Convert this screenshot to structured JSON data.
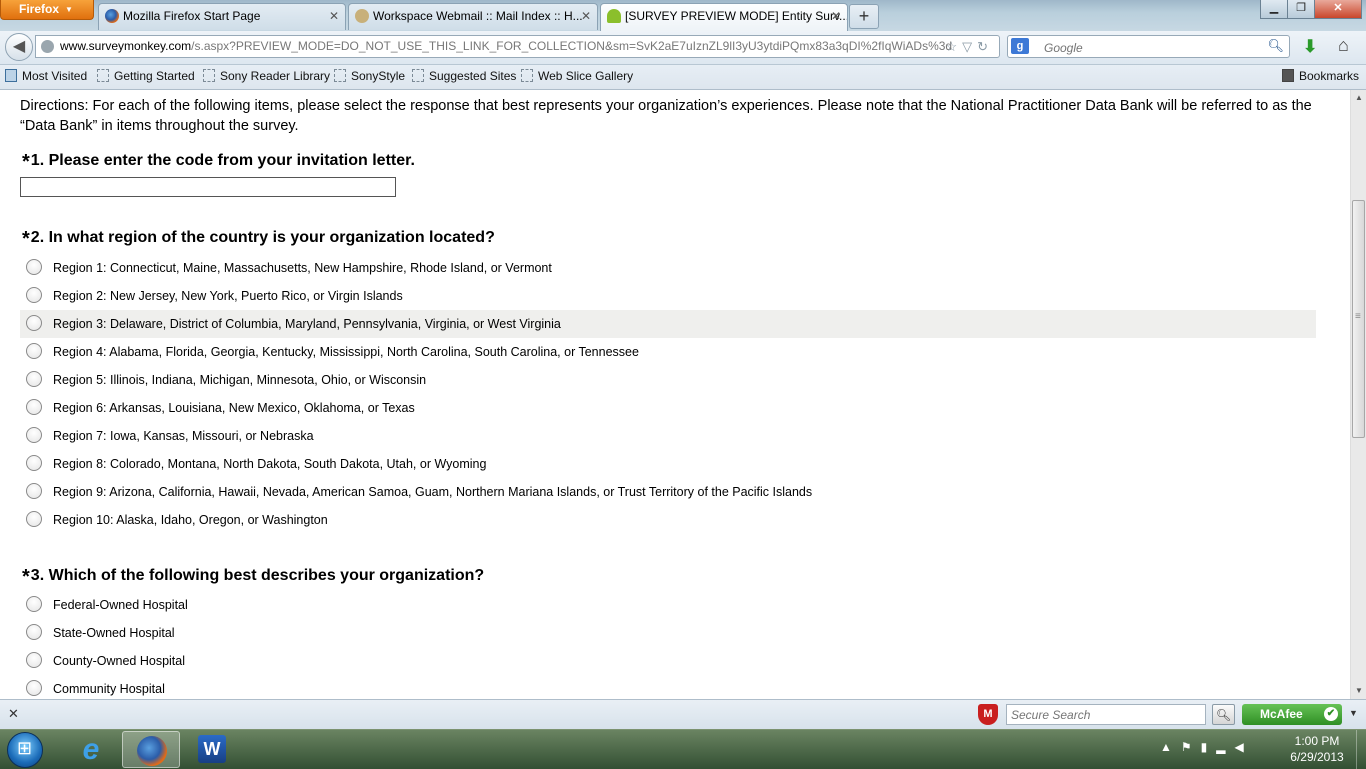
{
  "browser": {
    "menu_button": "Firefox",
    "tabs": [
      {
        "title": "Mozilla Firefox Start Page",
        "icon": "firefox-icon"
      },
      {
        "title": "Workspace Webmail :: Mail Index :: H...",
        "icon": "webmail-icon"
      },
      {
        "title": "[SURVEY PREVIEW MODE] Entity Surv...",
        "icon": "surveymonkey-icon",
        "active": true
      }
    ],
    "url_domain": "www.surveymonkey.com",
    "url_path": "/s.aspx?PREVIEW_MODE=DO_NOT_USE_THIS_LINK_FOR_COLLECTION&sm=SvK2aE7uIznZL9lI3yU3ytdiPQmx83a3qDI%2fIqWiADs%3d",
    "search_placeholder": "Google",
    "bookmarks": [
      "Most Visited",
      "Getting Started",
      "Sony Reader Library",
      "SonyStyle",
      "Suggested Sites",
      "Web Slice Gallery"
    ],
    "bookmarks_menu": "Bookmarks"
  },
  "survey": {
    "directions": "Directions: For each of the following items, please select the response that best represents your organization’s experiences. Please note that the National Practitioner Data Bank will be referred to as the “Data Bank” in items throughout the survey.",
    "required_marker": "*",
    "q1": {
      "title": "1. Please enter the code from your invitation letter.",
      "value": ""
    },
    "q2": {
      "title": "2. In what region of the country is your organization located?",
      "options": [
        "Region 1: Connecticut, Maine, Massachusetts, New Hampshire, Rhode Island, or Vermont",
        "Region 2: New Jersey, New York, Puerto Rico, or Virgin Islands",
        "Region 3: Delaware, District of Columbia, Maryland, Pennsylvania, Virginia, or West Virginia",
        "Region 4: Alabama, Florida, Georgia, Kentucky, Mississippi, North Carolina, South Carolina, or Tennessee",
        "Region 5: Illinois, Indiana, Michigan, Minnesota, Ohio, or Wisconsin",
        "Region 6: Arkansas, Louisiana, New Mexico, Oklahoma, or Texas",
        "Region 7: Iowa, Kansas, Missouri, or Nebraska",
        "Region 8: Colorado, Montana, North Dakota, South Dakota, Utah, or Wyoming",
        "Region 9: Arizona, California, Hawaii, Nevada, American Samoa, Guam, Northern Mariana Islands, or Trust Territory of the Pacific Islands",
        "Region 10: Alaska, Idaho, Oregon, or Washington"
      ]
    },
    "q3": {
      "title": "3. Which of the following best describes your organization?",
      "options": [
        "Federal-Owned Hospital",
        "State-Owned Hospital",
        "County-Owned Hospital",
        "Community Hospital"
      ]
    }
  },
  "addon_bar": {
    "secure_search_placeholder": "Secure Search",
    "mcafee_label": "McAfee"
  },
  "taskbar": {
    "time": "1:00 PM",
    "date": "6/29/2013"
  }
}
